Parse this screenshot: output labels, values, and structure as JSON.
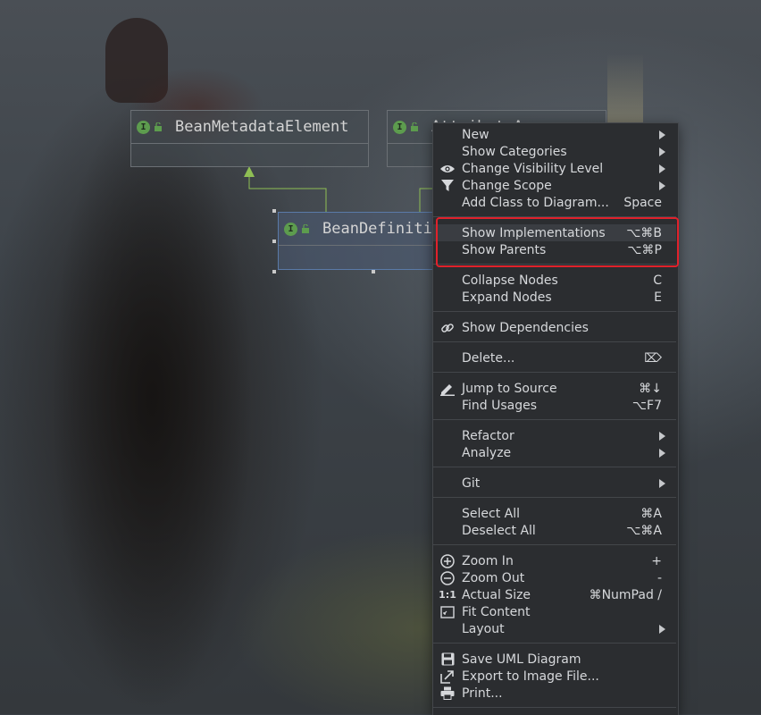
{
  "nodes": {
    "bean_metadata": "BeanMetadataElement",
    "attribute_accessor": "AttributeAccessor",
    "bean_definition": "BeanDefinition"
  },
  "menu": {
    "new": "New",
    "show_categories": "Show Categories",
    "change_visibility": "Change Visibility Level",
    "change_scope": "Change Scope",
    "add_class": "Add Class to Diagram...",
    "add_class_shortcut": "Space",
    "show_implementations": "Show Implementations",
    "show_implementations_shortcut": "⌥⌘B",
    "show_parents": "Show Parents",
    "show_parents_shortcut": "⌥⌘P",
    "collapse_nodes": "Collapse Nodes",
    "collapse_nodes_shortcut": "C",
    "expand_nodes": "Expand Nodes",
    "expand_nodes_shortcut": "E",
    "show_dependencies": "Show Dependencies",
    "delete": "Delete...",
    "delete_shortcut": "⌦",
    "jump_to_source": "Jump to Source",
    "jump_to_source_shortcut": "⌘↓",
    "find_usages": "Find Usages",
    "find_usages_shortcut": "⌥F7",
    "refactor": "Refactor",
    "analyze": "Analyze",
    "git": "Git",
    "select_all": "Select All",
    "select_all_shortcut": "⌘A",
    "deselect_all": "Deselect All",
    "deselect_all_shortcut": "⌥⌘A",
    "zoom_in": "Zoom In",
    "zoom_in_shortcut": "+",
    "zoom_out": "Zoom Out",
    "zoom_out_shortcut": "-",
    "actual_size": "Actual Size",
    "actual_size_icon_text": "1:1",
    "actual_size_shortcut": "⌘NumPad /",
    "fit_content": "Fit Content",
    "layout": "Layout",
    "save_uml": "Save UML Diagram",
    "export_image": "Export to Image File...",
    "print": "Print..."
  },
  "colors": {
    "menu_bg": "#2b2d30",
    "highlight_box": "#e0212b",
    "interface_icon": "#5d9c4e",
    "arrow": "#8fbf54"
  }
}
